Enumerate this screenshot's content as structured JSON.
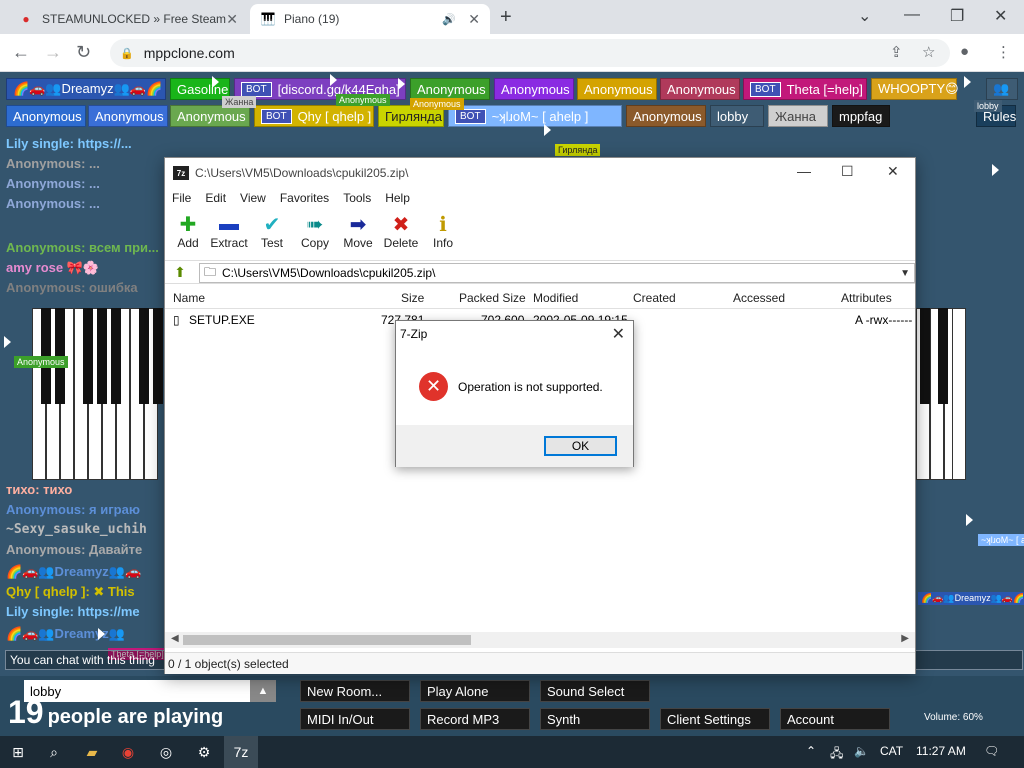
{
  "browser": {
    "tabs": [
      {
        "title": "STEAMUNLOCKED » Free Steam",
        "icon": "steam-unlocked-icon"
      },
      {
        "title": "Piano (19)",
        "icon": "piano-icon"
      }
    ],
    "url": "mppclone.com"
  },
  "page": {
    "users_row1": [
      {
        "name": "🌈🚗👥Dreamyz👥🚗🌈",
        "bot": false,
        "color": "#2b56b0"
      },
      {
        "name": "Gasoline",
        "bot": false,
        "color": "#19b519"
      },
      {
        "name": "[discord.gg/k44Eqha]",
        "bot": true,
        "color": "#7d3fc0"
      },
      {
        "name": "Anonymous",
        "bot": false,
        "color": "#3ca02a"
      },
      {
        "name": "Anonymous",
        "bot": false,
        "color": "#8a2be2"
      },
      {
        "name": "Anonymous",
        "bot": false,
        "color": "#d4a300"
      },
      {
        "name": "Anonymous",
        "bot": false,
        "color": "#b03a5b"
      },
      {
        "name": "Theta [=help]",
        "bot": true,
        "color": "#c2187a"
      },
      {
        "name": "WHOOPTY😊",
        "bot": false,
        "color": "#d9a21a"
      }
    ],
    "users_row2": [
      {
        "name": "Anonymous",
        "bot": false,
        "color": "#2d6cd0"
      },
      {
        "name": "Anonymous",
        "bot": false,
        "color": "#3a6fd8"
      },
      {
        "name": "Anonymous",
        "bot": false,
        "color": "#6aa84f"
      },
      {
        "name": "Qhy [ qhelp ]",
        "bot": true,
        "color": "#d2b300"
      },
      {
        "name": "Гирлянда",
        "bot": false,
        "color": "#c9d400"
      },
      {
        "name": "~ʞlɹoM~ [ ahelp ]",
        "bot": true,
        "color": "#7fb6ff"
      },
      {
        "name": "Anonymous",
        "bot": false,
        "color": "#8b5a2b"
      },
      {
        "name": "lobby",
        "bot": false,
        "color": "#3e5c74"
      },
      {
        "name": "Жанна",
        "bot": false,
        "color": "#cfcfcf"
      },
      {
        "name": "mppfag",
        "bot": false,
        "color": "#1a1a1a"
      }
    ],
    "bot_label": "BOT",
    "rules_label": "Rules",
    "chat_lines": [
      {
        "text": "Lily single: https://...",
        "color": "#7ec8ff"
      },
      {
        "text": "Anonymous: ...",
        "color": "#a0a0a0"
      },
      {
        "text": "Anonymous: ...",
        "color": "#8fa8d8"
      },
      {
        "text": "Anonymous: ...",
        "color": "#8fa8d8"
      },
      {
        "text": "Anonymous: всем при...",
        "color": "#6fb84f"
      },
      {
        "text": "amy rose 🎀🌸",
        "color": "#e68bd0"
      },
      {
        "text": "Anonymous: ошибка",
        "color": "#808080"
      },
      {
        "text": "тихо: тихо",
        "color": "#ffb0a0"
      },
      {
        "text": "Anonymous: я играю",
        "color": "#5c8fd8"
      },
      {
        "text": "~Sexy_sasuke_uchih",
        "color": "#bbbbbb"
      },
      {
        "text": "Anonymous: Давайте",
        "color": "#aaaaaa"
      },
      {
        "text": "🌈🚗👥Dreamyz👥🚗",
        "color": "#5c8fd8"
      },
      {
        "text": "Qhy [ qhelp ]: ✖ This",
        "color": "#d2c000"
      },
      {
        "text": "Lily single: https://me",
        "color": "#7ec8ff"
      },
      {
        "text": "🌈🚗👥Dreamyz👥",
        "color": "#5c8fd8"
      }
    ],
    "chat_placeholder": "You can chat with this thing",
    "room_name": "lobby",
    "player_count": "19",
    "player_text": "people are playing",
    "buttons": [
      "New Room...",
      "Play Alone",
      "Sound Select",
      "MIDI In/Out",
      "Record MP3",
      "Synth",
      "Client Settings",
      "Account"
    ],
    "volume": "Volume: 60%"
  },
  "zip": {
    "title": "C:\\Users\\VM5\\Downloads\\cpukil205.zip\\",
    "menu": [
      "File",
      "Edit",
      "View",
      "Favorites",
      "Tools",
      "Help"
    ],
    "toolbar": [
      {
        "label": "Add",
        "icon": "plus-icon",
        "color": "#22a822"
      },
      {
        "label": "Extract",
        "icon": "minus-icon",
        "color": "#1a3fbf"
      },
      {
        "label": "Test",
        "icon": "check-icon",
        "color": "#20b0c0"
      },
      {
        "label": "Copy",
        "icon": "copy-arrows-icon",
        "color": "#0a8a8a"
      },
      {
        "label": "Move",
        "icon": "move-arrow-icon",
        "color": "#1a2a9a"
      },
      {
        "label": "Delete",
        "icon": "x-icon",
        "color": "#d0201a"
      },
      {
        "label": "Info",
        "icon": "info-icon",
        "color": "#c09a00"
      }
    ],
    "path": "C:\\Users\\VM5\\Downloads\\cpukil205.zip\\",
    "columns": [
      "Name",
      "Size",
      "Packed Size",
      "Modified",
      "Created",
      "Accessed",
      "Attributes"
    ],
    "rows": [
      {
        "name": "SETUP.EXE",
        "size": "727 781",
        "packed": "702 600",
        "modified": "2002-05-09 19:15",
        "created": "",
        "accessed": "",
        "attributes": "A -rwx------"
      }
    ],
    "status": "0 / 1 object(s) selected"
  },
  "dialog": {
    "title": "7-Zip",
    "message": "Operation is not supported.",
    "ok_label": "OK"
  },
  "taskbar": {
    "lang": "CAT",
    "time": "11:27 AM"
  }
}
